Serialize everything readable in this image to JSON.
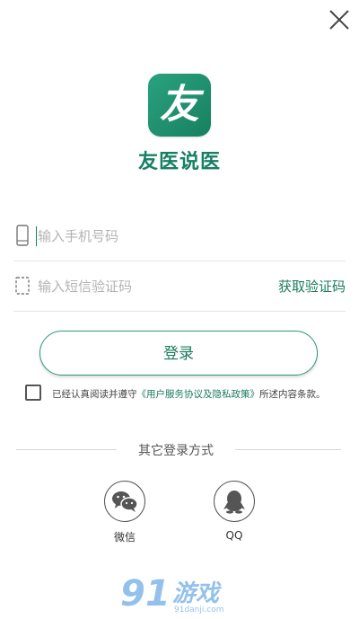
{
  "app": {
    "logo_char": "友",
    "name": "友医说医"
  },
  "form": {
    "phone_placeholder": "输入手机号码",
    "code_placeholder": "输入短信验证码",
    "get_code_label": "获取验证码",
    "login_label": "登录"
  },
  "agreement": {
    "prefix": "已经认真阅读并遵守",
    "link": "《用户服务协议及隐私政策》",
    "suffix": "所述内容条款。",
    "checked": false
  },
  "other_login": {
    "title": "其它登录方式",
    "wechat_label": "微信",
    "qq_label": "QQ"
  },
  "watermark": {
    "main": "游戏",
    "sub": "91danji.com"
  },
  "colors": {
    "accent": "#1a7a5e",
    "logo_bg": "#1f8f6c"
  }
}
